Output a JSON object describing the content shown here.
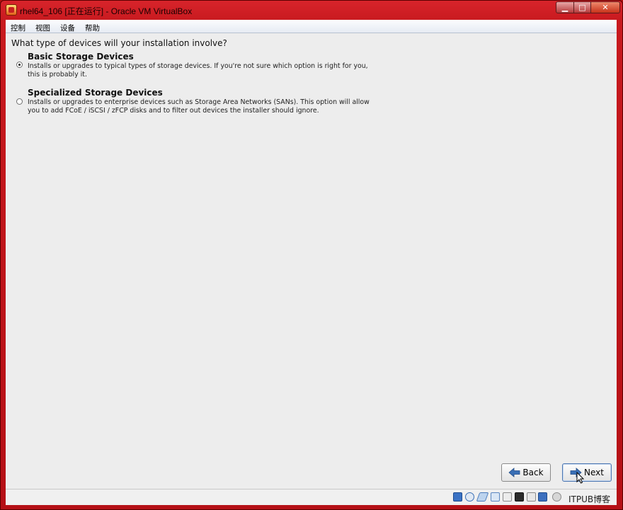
{
  "window": {
    "title": "rhel64_106 [正在运行] - Oracle VM VirtualBox",
    "minimize_glyph": "▁",
    "maximize_glyph": "□",
    "close_glyph": "✕"
  },
  "menubar": {
    "items": [
      "控制",
      "视图",
      "设备",
      "帮助"
    ]
  },
  "installer": {
    "question": "What type of devices will your installation involve?",
    "options": [
      {
        "title": "Basic Storage Devices",
        "desc_line1": "Installs or upgrades to typical types of storage devices.  If you're not sure which option is right for you,",
        "desc_line2": "this is probably it.",
        "selected": true
      },
      {
        "title": "Specialized Storage Devices",
        "desc_line1": "Installs or upgrades to enterprise devices such as Storage Area Networks (SANs). This option will allow",
        "desc_line2": "you to add FCoE / iSCSI / zFCP disks and to filter out devices the installer should ignore.",
        "selected": false
      }
    ],
    "back_label": "Back",
    "next_label": "Next"
  },
  "statusbar": {
    "icons": [
      "hard-disk-icon",
      "optical-drive-icon",
      "usb-icon",
      "shared-folders-icon",
      "display-icon",
      "network-icon",
      "video-capture-icon",
      "mouse-integration-icon",
      "keyboard-capture-icon"
    ],
    "watermark": "ITPUB博客"
  },
  "colors": {
    "frame": "#c81a1f",
    "screen_bg": "#ededed",
    "arrow_blue": "#3a6fb5"
  }
}
